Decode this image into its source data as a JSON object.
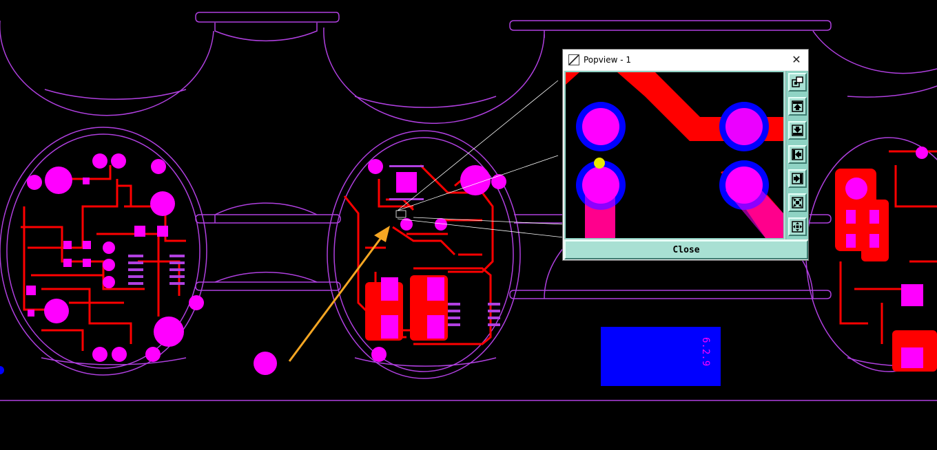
{
  "board": {
    "label_text": "6.2.9",
    "colors": {
      "outline": "#b040e0",
      "copper": "#ff0000",
      "pad": "#ff00ff",
      "plane": "#0000ff",
      "arrow": "#f5a623",
      "guide": "#ffffff"
    }
  },
  "popview": {
    "title": "Popview - 1",
    "close_x": "✕",
    "close_label": "Close",
    "tools": [
      {
        "name": "zoom-window-tool"
      },
      {
        "name": "pan-up-tool"
      },
      {
        "name": "pan-down-tool"
      },
      {
        "name": "pan-left-tool"
      },
      {
        "name": "pan-right-tool"
      },
      {
        "name": "zoom-out-tool"
      },
      {
        "name": "zoom-fit-tool"
      }
    ]
  }
}
